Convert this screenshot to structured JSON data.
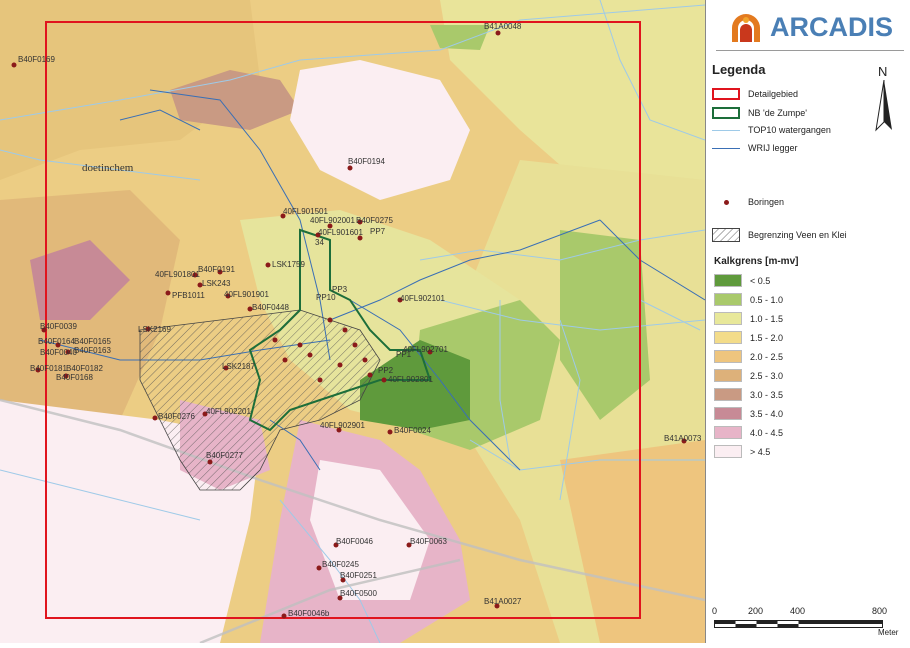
{
  "map": {
    "city_label": "doetinchem",
    "boreholes": [
      {
        "id": "B41A0048"
      },
      {
        "id": "B40F0169"
      },
      {
        "id": "B40F0194"
      },
      {
        "id": "40FL901501"
      },
      {
        "id": "40FL902001"
      },
      {
        "id": "B40F0275"
      },
      {
        "id": "PP7"
      },
      {
        "id": "40FL901601"
      },
      {
        "id": "34"
      },
      {
        "id": "LSK1759"
      },
      {
        "id": "40FL901801"
      },
      {
        "id": "B40F0191"
      },
      {
        "id": "LSK243"
      },
      {
        "id": "PFB1011"
      },
      {
        "id": "40FL901901"
      },
      {
        "id": "40FL902101"
      },
      {
        "id": "B40F0448"
      },
      {
        "id": "B40F0039"
      },
      {
        "id": "B40F0164"
      },
      {
        "id": "B40F0165"
      },
      {
        "id": "B40F0040"
      },
      {
        "id": "B40F0163"
      },
      {
        "id": "B40F0181"
      },
      {
        "id": "B40F0182"
      },
      {
        "id": "B40F0168"
      },
      {
        "id": "LSK2169"
      },
      {
        "id": "LSK2187"
      },
      {
        "id": "40FL902701"
      },
      {
        "id": "40FL902801"
      },
      {
        "id": "B40F0276"
      },
      {
        "id": "40FL902201"
      },
      {
        "id": "40FL902901"
      },
      {
        "id": "B40F0024"
      },
      {
        "id": "B40F0277"
      },
      {
        "id": "B41A0073"
      },
      {
        "id": "B40F0046"
      },
      {
        "id": "B40F0063"
      },
      {
        "id": "B40F0245"
      },
      {
        "id": "B40F0251"
      },
      {
        "id": "B40F0500"
      },
      {
        "id": "B41A0027"
      },
      {
        "id": "B40F0046b"
      },
      {
        "id": "PP1"
      },
      {
        "id": "PP2"
      },
      {
        "id": "PP3"
      },
      {
        "id": "PP10"
      }
    ]
  },
  "panel": {
    "logo_text": "ARCADIS",
    "legend_title": "Legenda",
    "north_label": "N",
    "items": [
      {
        "label": "Detailgebied"
      },
      {
        "label": "NB 'de Zumpe'"
      },
      {
        "label": "TOP10 watergangen"
      },
      {
        "label": "WRIJ legger"
      },
      {
        "label": "Boringen"
      },
      {
        "label": "Begrenzing Veen en Klei"
      }
    ],
    "class_title": "Kalkgrens [m-mv]",
    "classes": [
      {
        "label": "< 0.5",
        "color": "#5f9a3c"
      },
      {
        "label": "0.5 - 1.0",
        "color": "#a9c96b"
      },
      {
        "label": "1.0 - 1.5",
        "color": "#e8e89a"
      },
      {
        "label": "1.5 - 2.0",
        "color": "#f3dc8a"
      },
      {
        "label": "2.0 - 2.5",
        "color": "#eec57e"
      },
      {
        "label": "2.5 - 3.0",
        "color": "#ddb17a"
      },
      {
        "label": "3.0 - 3.5",
        "color": "#c99a83"
      },
      {
        "label": "3.5 - 4.0",
        "color": "#c78a96"
      },
      {
        "label": "4.0 - 4.5",
        "color": "#e7b4c8"
      },
      {
        "label": "> 4.5",
        "color": "#fbeef2"
      }
    ],
    "scale": {
      "ticks": [
        "0",
        "200",
        "400",
        "800"
      ],
      "unit": "Meter"
    },
    "colors": {
      "detail": "#e0141e",
      "zumpe": "#1d6e3a",
      "top10": "#9ecae8",
      "wrij": "#3a6fb5",
      "boring": "#8b1a1a"
    }
  }
}
